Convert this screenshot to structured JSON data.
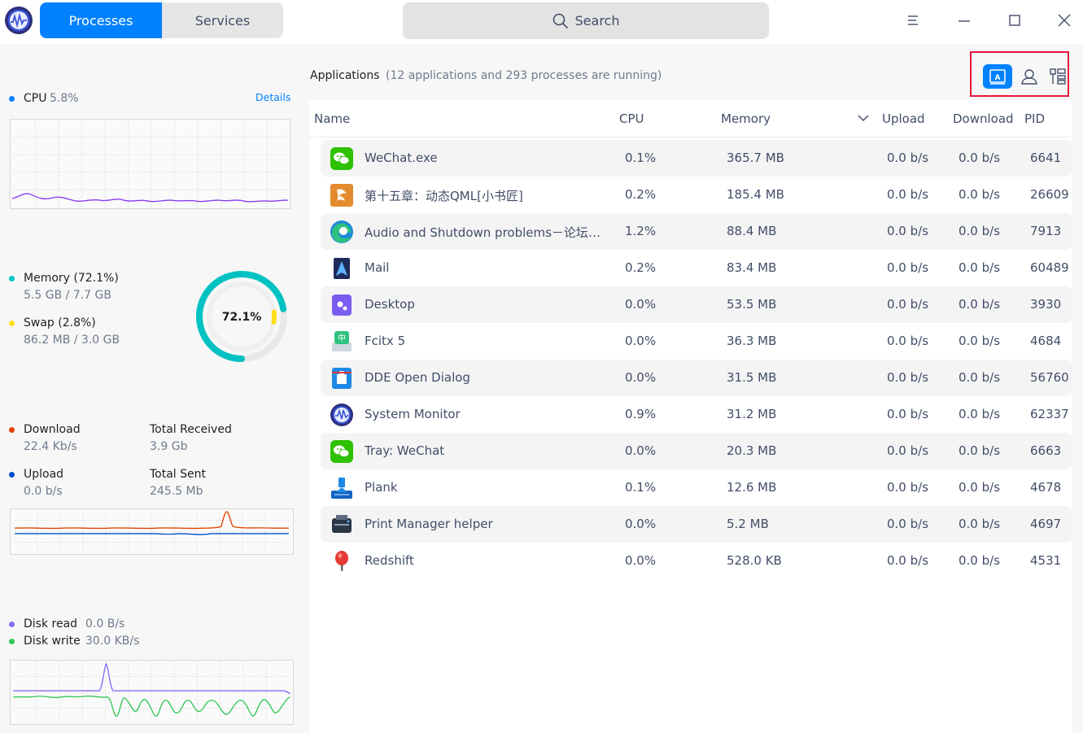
{
  "tabs": {
    "processes": "Processes",
    "services": "Services"
  },
  "search": {
    "label": "Search"
  },
  "cpu": {
    "label": "CPU",
    "value": "5.8%",
    "details": "Details"
  },
  "memory": {
    "label": "Memory (72.1%)",
    "used": "5.5 GB / 7.7 GB",
    "swap_label": "Swap (2.8%)",
    "swap_used": "86.2 MB / 3.0 GB",
    "ring_text": "72.1%",
    "memory_fraction": 0.721,
    "swap_fraction": 0.028
  },
  "network": {
    "download_label": "Download",
    "download_value": "22.4 Kb/s",
    "total_received_label": "Total Received",
    "total_received_value": "3.9 Gb",
    "upload_label": "Upload",
    "upload_value": "0.0 b/s",
    "total_sent_label": "Total Sent",
    "total_sent_value": "245.5 Mb"
  },
  "disk": {
    "read_label": "Disk read",
    "read_value": "0.0 B/s",
    "write_label": "Disk write",
    "write_value": "30.0 KB/s"
  },
  "colors": {
    "accent": "#0081ff",
    "cpu": "#0081ff",
    "memory": "#00c7c7",
    "swap": "#fede1c",
    "download": "#e14300",
    "upload": "#0050d0",
    "disk_read": "#8b6cf6",
    "disk_write": "#34c759"
  },
  "apps": {
    "title": "Applications",
    "subtitle": "(12 applications and 293 processes are running)"
  },
  "columns": {
    "name": "Name",
    "cpu": "CPU",
    "memory": "Memory",
    "upload": "Upload",
    "download": "Download",
    "pid": "PID"
  },
  "rows": [
    {
      "icon": "wechat-icon",
      "name": "WeChat.exe",
      "cpu": "0.1%",
      "memory": "365.7 MB",
      "upload": "0.0 b/s",
      "download": "0.0 b/s",
      "pid": "6641"
    },
    {
      "icon": "book-reader-icon",
      "name": "第十五章：动态QML[小书匠]",
      "cpu": "0.2%",
      "memory": "185.4 MB",
      "upload": "0.0 b/s",
      "download": "0.0 b/s",
      "pid": "26609"
    },
    {
      "icon": "edge-browser-icon",
      "name": "Audio and Shutdown problems－论坛－…",
      "cpu": "1.2%",
      "memory": "88.4 MB",
      "upload": "0.0 b/s",
      "download": "0.0 b/s",
      "pid": "7913"
    },
    {
      "icon": "mail-icon",
      "name": "Mail",
      "cpu": "0.2%",
      "memory": "83.4 MB",
      "upload": "0.0 b/s",
      "download": "0.0 b/s",
      "pid": "60489"
    },
    {
      "icon": "desktop-icon",
      "name": "Desktop",
      "cpu": "0.0%",
      "memory": "53.5 MB",
      "upload": "0.0 b/s",
      "download": "0.0 b/s",
      "pid": "3930"
    },
    {
      "icon": "keyboard-icon",
      "name": "Fcitx 5",
      "cpu": "0.0%",
      "memory": "36.3 MB",
      "upload": "0.0 b/s",
      "download": "0.0 b/s",
      "pid": "4684"
    },
    {
      "icon": "file-dialog-icon",
      "name": "DDE Open Dialog",
      "cpu": "0.0%",
      "memory": "31.5 MB",
      "upload": "0.0 b/s",
      "download": "0.0 b/s",
      "pid": "56760"
    },
    {
      "icon": "system-monitor-icon",
      "name": "System Monitor",
      "cpu": "0.9%",
      "memory": "31.2 MB",
      "upload": "0.0 b/s",
      "download": "0.0 b/s",
      "pid": "62337"
    },
    {
      "icon": "wechat-icon",
      "name": "Tray: WeChat",
      "cpu": "0.0%",
      "memory": "20.3 MB",
      "upload": "0.0 b/s",
      "download": "0.0 b/s",
      "pid": "6663"
    },
    {
      "icon": "dock-icon",
      "name": "Plank",
      "cpu": "0.1%",
      "memory": "12.6 MB",
      "upload": "0.0 b/s",
      "download": "0.0 b/s",
      "pid": "4678"
    },
    {
      "icon": "printer-icon",
      "name": "Print Manager helper",
      "cpu": "0.0%",
      "memory": "5.2 MB",
      "upload": "0.0 b/s",
      "download": "0.0 b/s",
      "pid": "4697"
    },
    {
      "icon": "pin-icon",
      "name": "Redshift",
      "cpu": "0.0%",
      "memory": "528.0 KB",
      "upload": "0.0 b/s",
      "download": "0.0 b/s",
      "pid": "4531"
    }
  ]
}
